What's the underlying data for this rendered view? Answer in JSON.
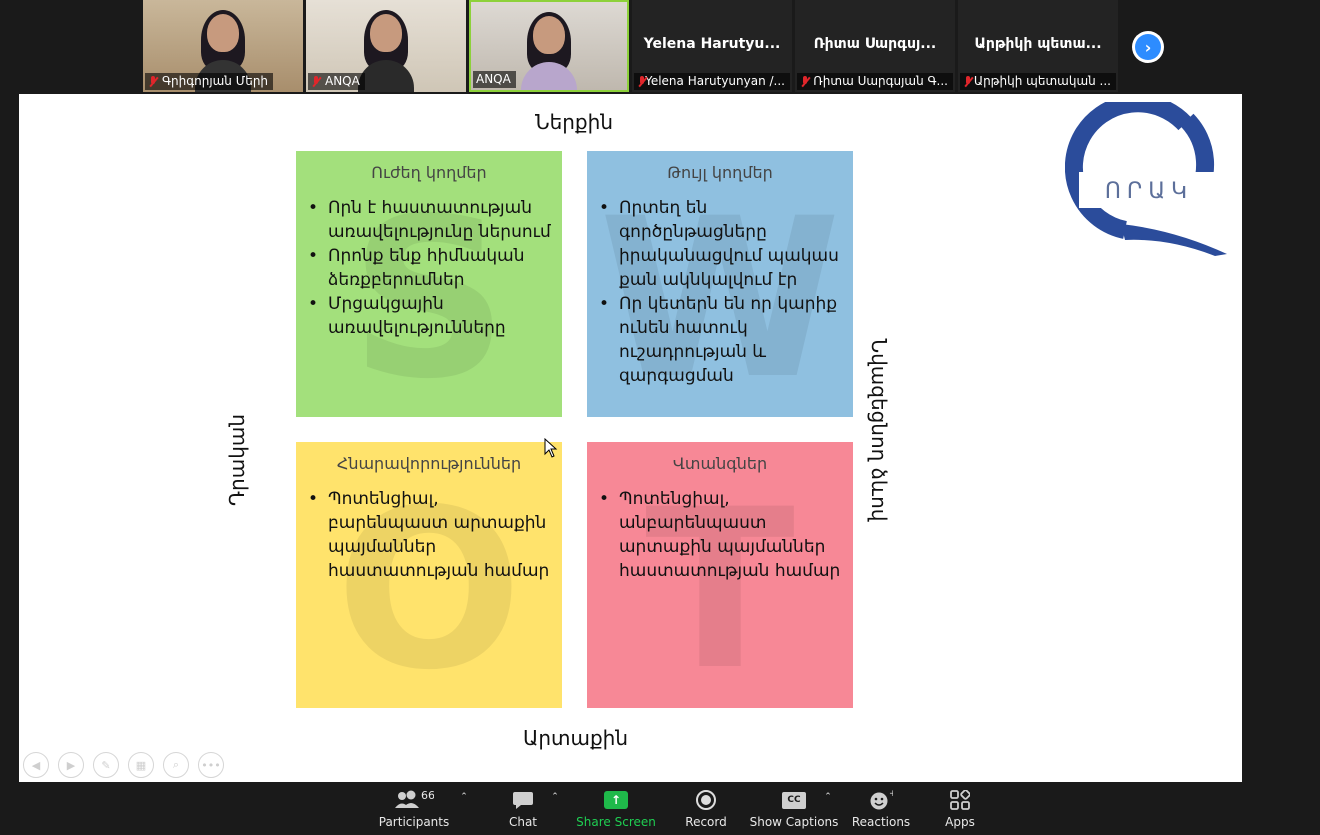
{
  "participants": [
    {
      "name": "Գրիգորյան Մերի",
      "video": true,
      "muted": true
    },
    {
      "name": "ANQA",
      "video": true,
      "muted": true
    },
    {
      "name": "ANQA",
      "video": true,
      "muted": false,
      "active_speaker": true
    },
    {
      "display": "Yelena  Harutyu...",
      "name": "Yelena Harutyunyan /...",
      "video": false,
      "muted": true
    },
    {
      "display": "Ռիտա Սարգսյ...",
      "name": "Ռիտա Սարգսյան Գ...",
      "video": false,
      "muted": true
    },
    {
      "display": "Արթիկի պետա...",
      "name": "Արթիկի պետական ...",
      "video": false,
      "muted": true
    }
  ],
  "slide": {
    "axis_top": "Ներքին",
    "axis_bottom": "Արտաքին",
    "axis_left": "Դրական",
    "axis_right": "Նվազեցնող ձևով",
    "logo_text": "ՈՐԱԿ",
    "quadrants": {
      "strengths": {
        "title": "Ուժեղ կողմեր",
        "letter": "S",
        "items": [
          "Որն է հաստատության առավելությունը ներսում",
          "Որոնք ենք հիմնական ձեռքբերումներ",
          "Մրցակցային առավելությունները"
        ]
      },
      "weaknesses": {
        "title": "Թույլ կողմեր",
        "letter": "W",
        "items": [
          "Որտեղ են գործընթացները իրականացվում պակաս քան ակնկալվում էր",
          "Որ կետերն են որ կարիք ունեն հատուկ ուշադրության և զարգացման"
        ]
      },
      "opportunities": {
        "title": "Հնարավորություններ",
        "letter": "O",
        "items": [
          "Պոտենցիալ, բարենպաստ արտաքին պայմաններ հաստատության համար"
        ]
      },
      "threats": {
        "title": "Վտանգներ",
        "letter": "T",
        "items": [
          "Պոտենցիալ, անբարենպաստ արտաքին պայմաններ հաստատության համար"
        ]
      }
    }
  },
  "toolbar": {
    "participants_label": "Participants",
    "participants_count": "66",
    "chat_label": "Chat",
    "share_label": "Share Screen",
    "record_label": "Record",
    "captions_label": "Show Captions",
    "reactions_label": "Reactions",
    "apps_label": "Apps"
  },
  "colors": {
    "strengths": "#a3e07c",
    "weaknesses": "#8fc0e0",
    "opportunities": "#ffe36c",
    "threats": "#f78896",
    "share_green": "#1fce52",
    "logo_blue": "#2b4c9b"
  }
}
